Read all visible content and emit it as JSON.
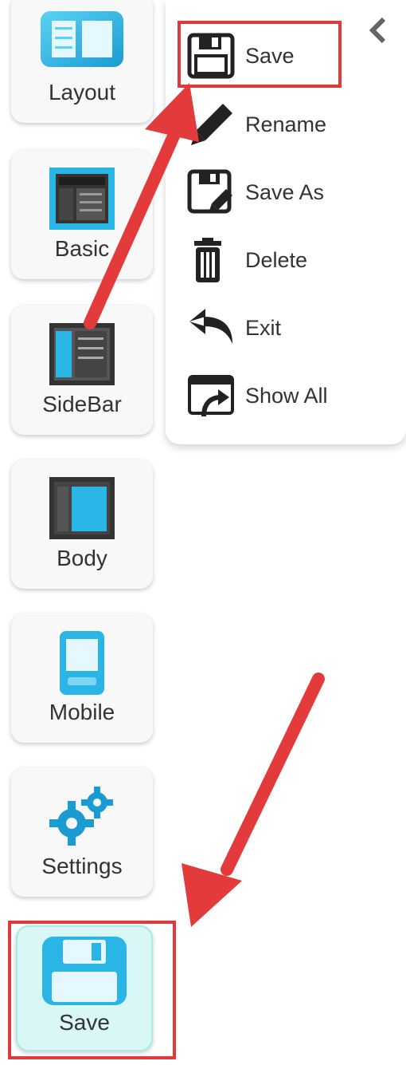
{
  "sidebar": {
    "items": [
      {
        "label": "Layout"
      },
      {
        "label": "Basic"
      },
      {
        "label": "SideBar"
      },
      {
        "label": "Body"
      },
      {
        "label": "Mobile"
      },
      {
        "label": "Settings"
      },
      {
        "label": "Save"
      }
    ]
  },
  "menu": {
    "items": [
      {
        "label": "Save",
        "icon": "floppy-disk-icon"
      },
      {
        "label": "Rename",
        "icon": "pencil-icon"
      },
      {
        "label": "Save As",
        "icon": "save-as-icon"
      },
      {
        "label": "Delete",
        "icon": "trash-icon"
      },
      {
        "label": "Exit",
        "icon": "undo-arrow-icon"
      },
      {
        "label": "Show All",
        "icon": "show-all-window-icon"
      }
    ]
  },
  "colors": {
    "accent": "#29b6e6",
    "highlight": "#e23a3a",
    "save_tile_bg": "#d9f7f6"
  }
}
